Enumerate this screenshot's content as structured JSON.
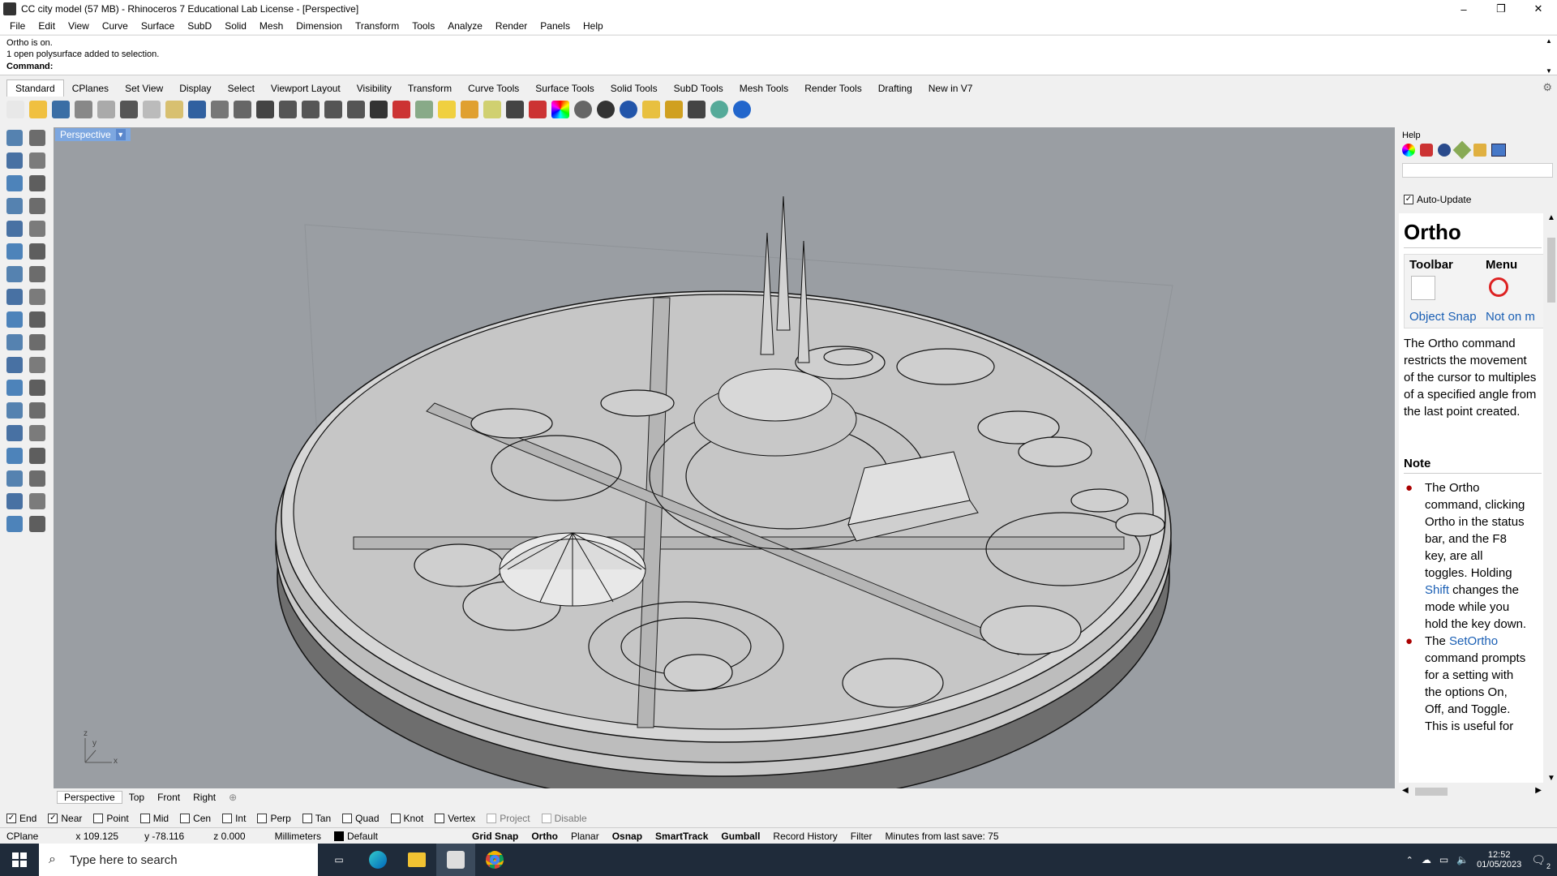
{
  "window": {
    "title": "CC city model (57 MB) - Rhinoceros 7 Educational Lab License - [Perspective]",
    "min": "–",
    "max": "❐",
    "close": "✕"
  },
  "menu": [
    "File",
    "Edit",
    "View",
    "Curve",
    "Surface",
    "SubD",
    "Solid",
    "Mesh",
    "Dimension",
    "Transform",
    "Tools",
    "Analyze",
    "Render",
    "Panels",
    "Help"
  ],
  "history": {
    "line1": "Ortho is on.",
    "line2": "1 open polysurface added to selection.",
    "command_label": "Command:",
    "command_value": ""
  },
  "toolbar_tabs": [
    "Standard",
    "CPlanes",
    "Set View",
    "Display",
    "Select",
    "Viewport Layout",
    "Visibility",
    "Transform",
    "Curve Tools",
    "Surface Tools",
    "Solid Tools",
    "SubD Tools",
    "Mesh Tools",
    "Render Tools",
    "Drafting",
    "New in V7"
  ],
  "toolbar_icons": [
    "new-icon",
    "open-icon",
    "save-icon",
    "print-icon",
    "import-icon",
    "cut-icon",
    "copy-icon",
    "paste-icon",
    "undo-icon",
    "pan-hand-icon",
    "move-view-icon",
    "zoom-icon",
    "zoom-window-icon",
    "zoom-extents-icon",
    "zoom-selected-icon",
    "rotate-view-icon",
    "four-viewports-icon",
    "car-icon",
    "cplane-icon",
    "snap-icon",
    "points-icon",
    "light-icon",
    "lock-icon",
    "material-icon",
    "color-wheel-icon",
    "shaded-icon",
    "rendered-icon",
    "sphere-icon",
    "filter-icon",
    "options-icon",
    "dimension-icon",
    "globe-icon",
    "help-icon"
  ],
  "viewport": {
    "label": "Perspective",
    "axis_z": "z",
    "axis_y": "y",
    "axis_x": "x"
  },
  "viewport_tabs": [
    "Perspective",
    "Top",
    "Front",
    "Right",
    "⊕"
  ],
  "help_panel": {
    "title": "Help",
    "auto_update": "Auto-Update",
    "heading": "Ortho",
    "toolbar_col": "Toolbar",
    "menu_col": "Menu",
    "toolbar_link": "Object Snap",
    "menu_link": "Not on m",
    "description": "The Ortho command restricts the movement of the cursor to multiples of a specified angle from the last point created.",
    "note_heading": "Note",
    "note1_pre": "The Ortho command, clicking Ortho in the status bar, and the F8 key, are all toggles. Holding ",
    "note1_link": "Shift",
    "note1_post": " changes the mode while you hold the key down.",
    "note2_pre": "The ",
    "note2_link": "SetOrtho",
    "note2_post": " command prompts for a setting with the options On, Off, and Toggle. This is useful for"
  },
  "osnaps": [
    {
      "label": "End",
      "checked": true,
      "disabled": false
    },
    {
      "label": "Near",
      "checked": true,
      "disabled": false
    },
    {
      "label": "Point",
      "checked": false,
      "disabled": false
    },
    {
      "label": "Mid",
      "checked": false,
      "disabled": false
    },
    {
      "label": "Cen",
      "checked": false,
      "disabled": false
    },
    {
      "label": "Int",
      "checked": false,
      "disabled": false
    },
    {
      "label": "Perp",
      "checked": false,
      "disabled": false
    },
    {
      "label": "Tan",
      "checked": false,
      "disabled": false
    },
    {
      "label": "Quad",
      "checked": false,
      "disabled": false
    },
    {
      "label": "Knot",
      "checked": false,
      "disabled": false
    },
    {
      "label": "Vertex",
      "checked": false,
      "disabled": false
    },
    {
      "label": "Project",
      "checked": false,
      "disabled": true
    },
    {
      "label": "Disable",
      "checked": false,
      "disabled": true
    }
  ],
  "status": {
    "cplane": "CPlane",
    "x": "x 109.125",
    "y": "y -78.116",
    "z": "z 0.000",
    "units": "Millimeters",
    "layer": "Default",
    "grid_snap": "Grid Snap",
    "ortho": "Ortho",
    "planar": "Planar",
    "osnap": "Osnap",
    "smarttrack": "SmartTrack",
    "gumball": "Gumball",
    "record_history": "Record History",
    "filter": "Filter",
    "save_msg": "Minutes from last save: 75"
  },
  "taskbar": {
    "search_placeholder": "Type here to search",
    "time": "12:52",
    "date": "01/05/2023",
    "notifications": "2"
  },
  "colors": {
    "viewport_bg": "#9a9ea3",
    "viewport_label_bg": "#7da7e0",
    "link": "#1a5fb4",
    "taskbar": "#1f2b3a"
  }
}
